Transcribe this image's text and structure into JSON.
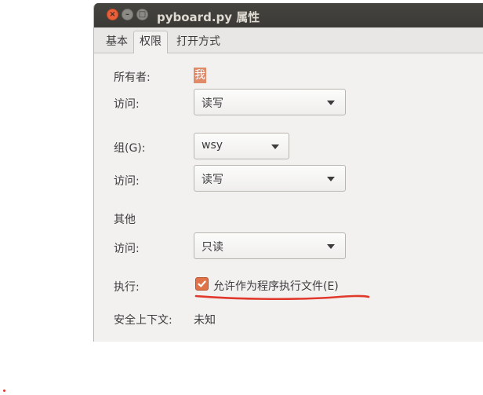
{
  "window": {
    "title": "pyboard.py 属性"
  },
  "tabs": [
    {
      "label": "基本"
    },
    {
      "label": "权限"
    },
    {
      "label": "打开方式"
    }
  ],
  "permissions": {
    "owner_label": "所有者:",
    "owner_value": "我",
    "owner_access_label": "访问:",
    "owner_access_value": "读写",
    "group_label": "组(G):",
    "group_value": "wsy",
    "group_access_label": "访问:",
    "group_access_value": "读写",
    "others_heading": "其他",
    "others_access_label": "访问:",
    "others_access_value": "只读",
    "execute_label": "执行:",
    "execute_checkbox_label": "允许作为程序执行文件(E)",
    "execute_checked": true,
    "security_context_label": "安全上下文:",
    "security_context_value": "未知"
  },
  "colors": {
    "accent": "#e0724a",
    "annotation": "#e0392b",
    "titlebar": "#3b3a36"
  }
}
